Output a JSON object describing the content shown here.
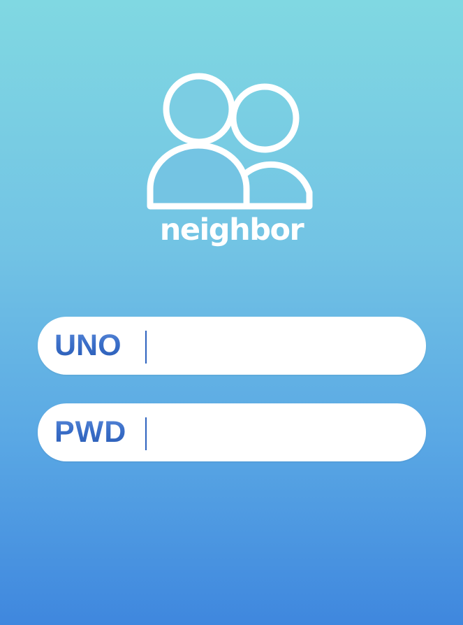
{
  "app": {
    "brand_name": "neighbor",
    "logo_icon": "people-icon"
  },
  "form": {
    "username": {
      "label": "UNO",
      "value": "",
      "placeholder": ""
    },
    "password": {
      "label": "PWD",
      "value": "",
      "placeholder": ""
    }
  },
  "colors": {
    "background_top": "#80d8e2",
    "background_bottom": "#3f87de",
    "label_blue": "#3b6fc9",
    "field_background": "#ffffff",
    "logo_white": "#ffffff"
  }
}
